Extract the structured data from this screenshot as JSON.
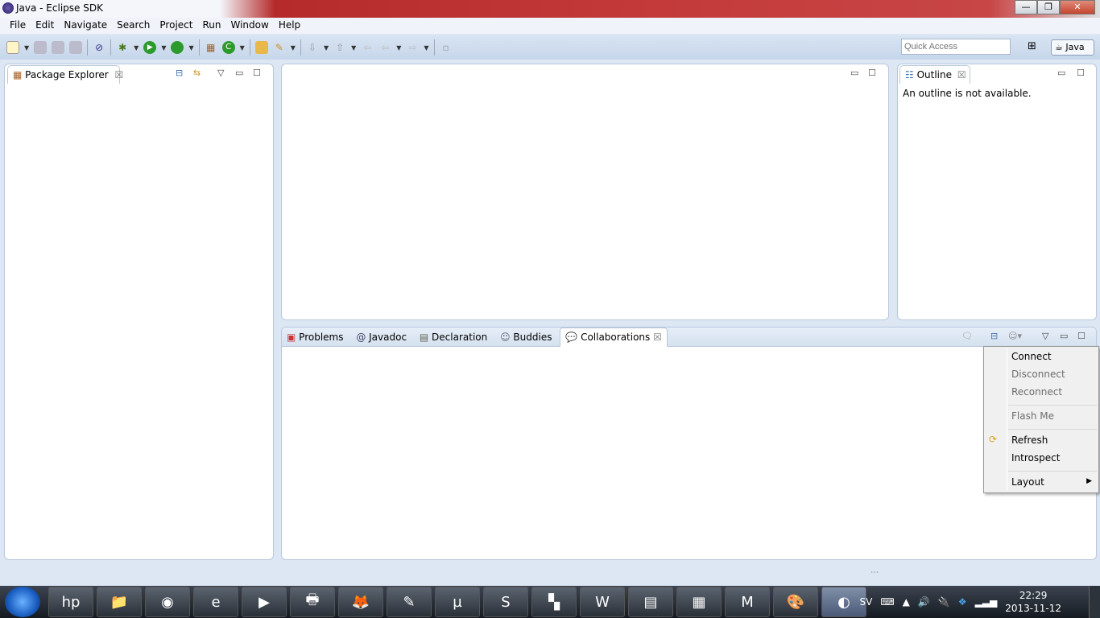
{
  "window": {
    "title": "Java - Eclipse SDK",
    "minimize": "—",
    "restore": "❐",
    "close": "✕"
  },
  "menubar": [
    "File",
    "Edit",
    "Navigate",
    "Search",
    "Project",
    "Run",
    "Window",
    "Help"
  ],
  "toolbar": {
    "quick_access_placeholder": "Quick Access",
    "perspective": "Java",
    "icons": [
      "new-icon",
      "save-icon",
      "save-all-icon",
      "print-icon",
      "skip-breakpoints-icon",
      "debug-icon",
      "run-icon",
      "external-tools-icon",
      "new-package-icon",
      "new-class-icon",
      "open-type-icon",
      "search-icon",
      "next-annotation-icon",
      "prev-annotation-icon",
      "last-edit-icon",
      "back-icon",
      "forward-icon",
      "pin-icon"
    ]
  },
  "package_explorer": {
    "title": "Package Explorer"
  },
  "outline": {
    "title": "Outline",
    "message": "An outline is not available."
  },
  "bottom": {
    "tabs": [
      "Problems",
      "Javadoc",
      "Declaration",
      "Buddies",
      "Collaborations"
    ]
  },
  "context_menu": {
    "items": [
      {
        "label": "Connect",
        "enabled": true
      },
      {
        "label": "Disconnect",
        "enabled": false
      },
      {
        "label": "Reconnect",
        "enabled": false
      },
      {
        "label": "Flash Me",
        "enabled": false
      },
      {
        "label": "Refresh",
        "enabled": true,
        "icon": "refresh-icon"
      },
      {
        "label": "Introspect",
        "enabled": true
      },
      {
        "label": "Layout",
        "enabled": true,
        "submenu": true
      }
    ]
  },
  "tray": {
    "language": "SV",
    "time": "22:29",
    "date": "2013-11-12"
  },
  "taskbar": [
    "hp",
    "explorer",
    "chrome",
    "internet-explorer",
    "media-player",
    "printer",
    "firefox",
    "notepad",
    "utorrent",
    "skype",
    "app",
    "word",
    "winrar",
    "calculator",
    "mcafee",
    "paint",
    "eclipse"
  ]
}
